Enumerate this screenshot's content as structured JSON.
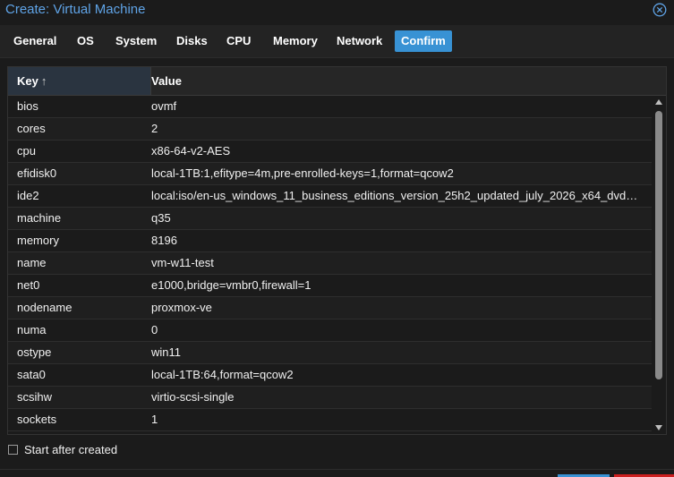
{
  "window": {
    "title": "Create: Virtual Machine",
    "close_icon": "close-circle-icon"
  },
  "tabs": [
    {
      "label": "General",
      "active": false
    },
    {
      "label": "OS",
      "active": false
    },
    {
      "label": "System",
      "active": false
    },
    {
      "label": "Disks",
      "active": false
    },
    {
      "label": "CPU",
      "active": false
    },
    {
      "label": "Memory",
      "active": false
    },
    {
      "label": "Network",
      "active": false
    },
    {
      "label": "Confirm",
      "active": true
    }
  ],
  "grid": {
    "columns": {
      "key": "Key",
      "value": "Value",
      "sort_icon": "sort-ascending-icon",
      "sort_glyph": "↑"
    },
    "rows": [
      {
        "key": "bios",
        "value": "ovmf"
      },
      {
        "key": "cores",
        "value": "2"
      },
      {
        "key": "cpu",
        "value": "x86-64-v2-AES"
      },
      {
        "key": "efidisk0",
        "value": "local-1TB:1,efitype=4m,pre-enrolled-keys=1,format=qcow2"
      },
      {
        "key": "ide2",
        "value": "local:iso/en-us_windows_11_business_editions_version_25h2_updated_july_2026_x64_dvd…"
      },
      {
        "key": "machine",
        "value": "q35"
      },
      {
        "key": "memory",
        "value": "8196"
      },
      {
        "key": "name",
        "value": "vm-w11-test"
      },
      {
        "key": "net0",
        "value": "e1000,bridge=vmbr0,firewall=1"
      },
      {
        "key": "nodename",
        "value": "proxmox-ve"
      },
      {
        "key": "numa",
        "value": "0"
      },
      {
        "key": "ostype",
        "value": "win11"
      },
      {
        "key": "sata0",
        "value": "local-1TB:64,format=qcow2"
      },
      {
        "key": "scsihw",
        "value": "virtio-scsi-single"
      },
      {
        "key": "sockets",
        "value": "1"
      }
    ]
  },
  "footer": {
    "start_after_created_label": "Start after created",
    "start_after_created_checked": false
  },
  "colors": {
    "title": "#5fa3e6",
    "active_tab": "#3892d4",
    "button_blue": "#3892d4",
    "button_red": "#cc1f1f"
  }
}
